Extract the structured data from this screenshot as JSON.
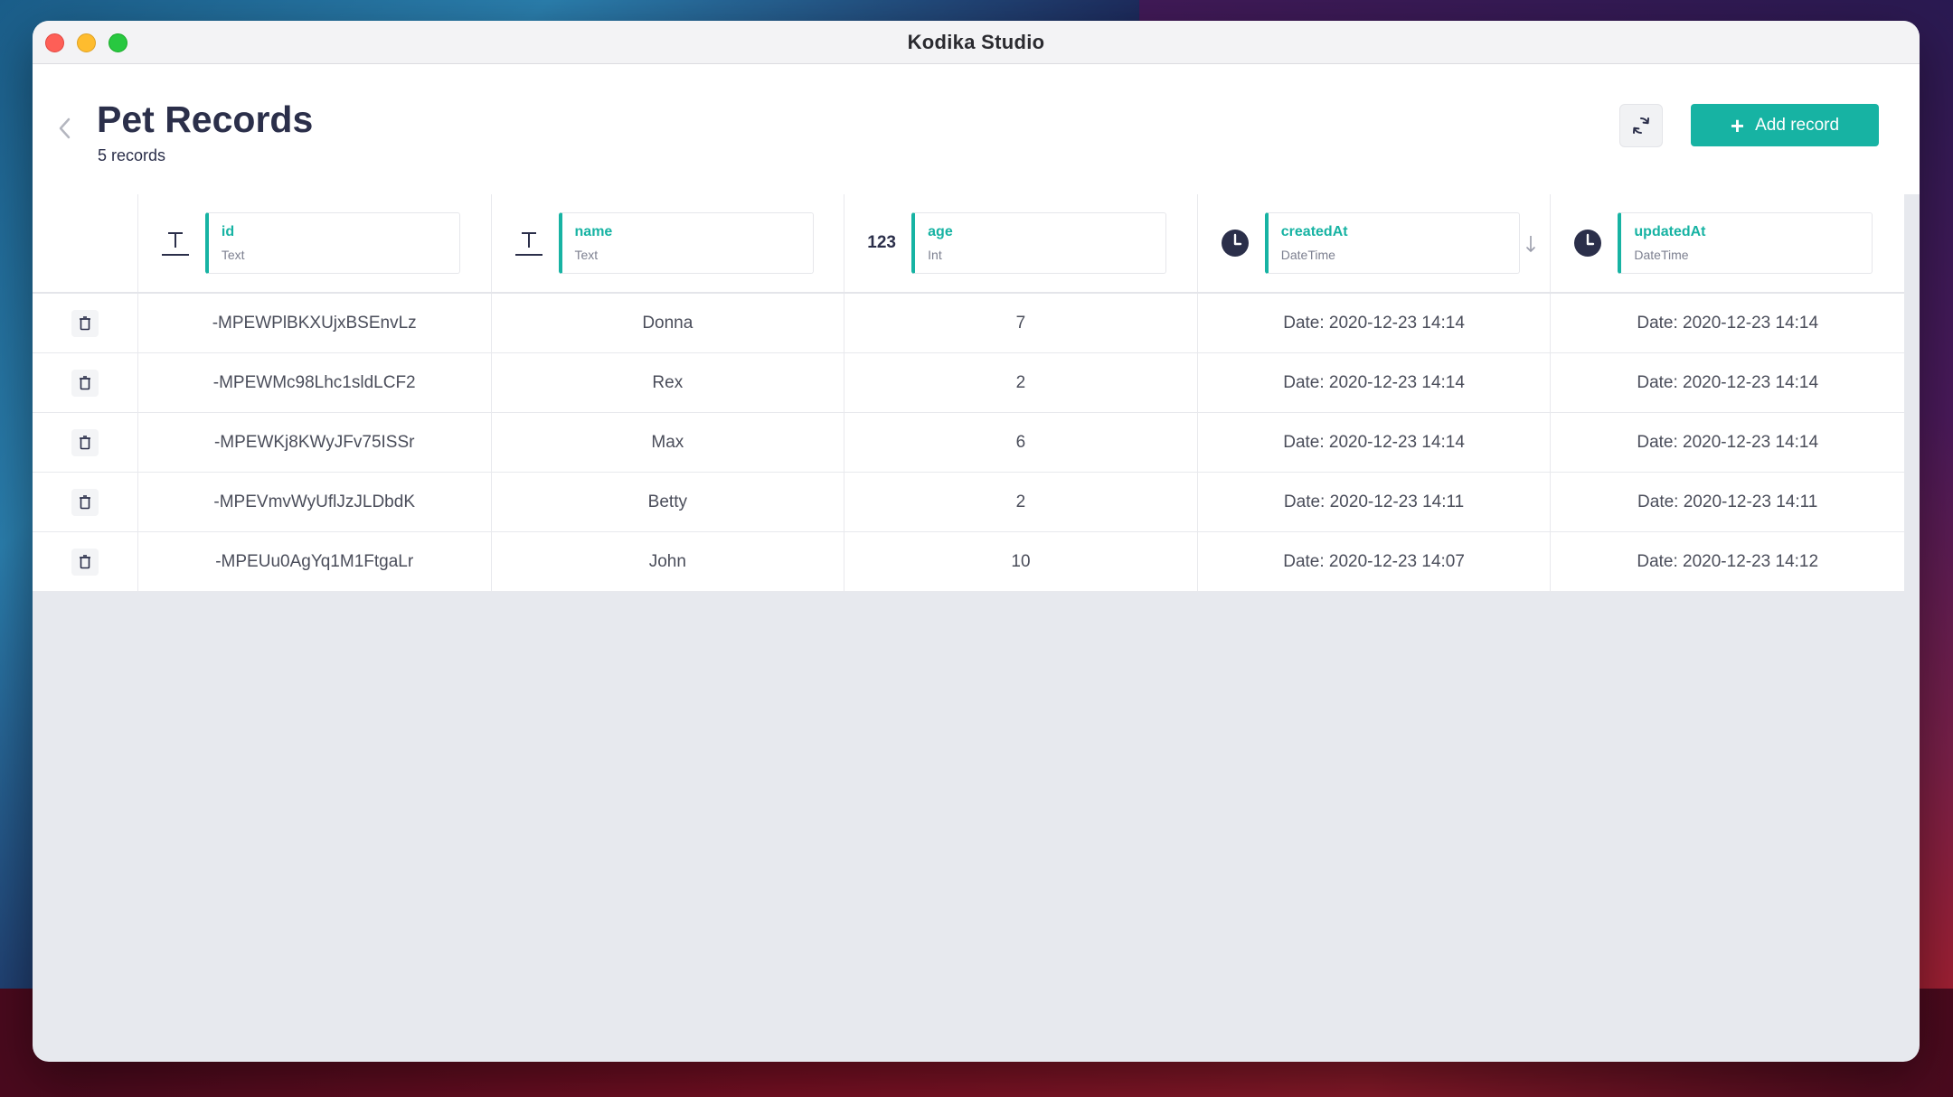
{
  "window": {
    "title": "Kodika Studio"
  },
  "header": {
    "title": "Pet Records",
    "subtitle": "5 records",
    "add_button_label": "Add record"
  },
  "columns": [
    {
      "name": "id",
      "type": "Text",
      "icon": "text-type-icon"
    },
    {
      "name": "name",
      "type": "Text",
      "icon": "text-type-icon"
    },
    {
      "name": "age",
      "type": "Int",
      "icon_label": "123"
    },
    {
      "name": "createdAt",
      "type": "DateTime",
      "icon": "clock-icon",
      "sorted": "descending"
    },
    {
      "name": "updatedAt",
      "type": "DateTime",
      "icon": "clock-icon"
    }
  ],
  "rows": [
    {
      "id": "-MPEWPlBKXUjxBSEnvLz",
      "name": "Donna",
      "age": "7",
      "createdAt": "Date: 2020-12-23 14:14",
      "updatedAt": "Date: 2020-12-23 14:14"
    },
    {
      "id": "-MPEWMc98Lhc1sldLCF2",
      "name": "Rex",
      "age": "2",
      "createdAt": "Date: 2020-12-23 14:14",
      "updatedAt": "Date: 2020-12-23 14:14"
    },
    {
      "id": "-MPEWKj8KWyJFv75ISSr",
      "name": "Max",
      "age": "6",
      "createdAt": "Date: 2020-12-23 14:14",
      "updatedAt": "Date: 2020-12-23 14:14"
    },
    {
      "id": "-MPEVmvWyUflJzJLDbdK",
      "name": "Betty",
      "age": "2",
      "createdAt": "Date: 2020-12-23 14:11",
      "updatedAt": "Date: 2020-12-23 14:11"
    },
    {
      "id": "-MPEUu0AgYq1M1FtgaLr",
      "name": "John",
      "age": "10",
      "createdAt": "Date: 2020-12-23 14:07",
      "updatedAt": "Date: 2020-12-23 14:12"
    }
  ],
  "colors": {
    "accent": "#17b3a3",
    "title": "#2b2f4a"
  }
}
